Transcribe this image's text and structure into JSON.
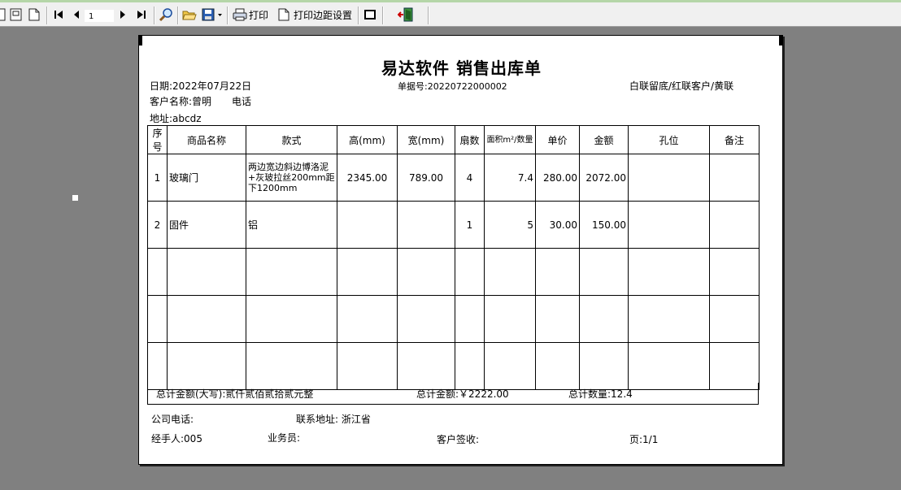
{
  "toolbar": {
    "page_number": "1",
    "print_label": "打印",
    "print_margin_label": "打印边距设置"
  },
  "icons": [
    "page-view-icon",
    "two-page-icon",
    "blank-page-icon",
    "first-page-icon",
    "prev-page-icon",
    "next-page-icon",
    "last-page-icon",
    "zoom-icon",
    "open-folder-icon",
    "save-disk-icon",
    "dropdown-arrow-icon",
    "printer-icon",
    "page-setup-icon",
    "fullscreen-icon",
    "exit-icon"
  ],
  "document": {
    "title": "易达软件 销售出库单",
    "date": "日期:2022年07月22日",
    "bill_no": "单据号:20220722000002",
    "copy_note": "白联留底/红联客户/黄联",
    "customer_name": "客户名称:曾明",
    "phone_label": "电话",
    "address": "地址:abcdz",
    "columns": [
      "序号",
      "商品名称",
      "款式",
      "高(mm)",
      "宽(mm)",
      "扇数",
      "面积m²/数量",
      "单价",
      "金额",
      "孔位",
      "备注"
    ],
    "rows": [
      {
        "no": "1",
        "name": "玻璃门",
        "style": "两边宽边斜边博洛泥+灰玻拉丝200mm距下1200mm",
        "height": "2345.00",
        "width": "789.00",
        "leaves": "4",
        "area": "7.4",
        "price": "280.00",
        "amount": "2072.00",
        "holes": "",
        "note": ""
      },
      {
        "no": "2",
        "name": "固件",
        "style": "铝",
        "height": "",
        "width": "",
        "leaves": "1",
        "area": "5",
        "price": "30.00",
        "amount": "150.00",
        "holes": "",
        "note": ""
      }
    ],
    "total_upper": "总计金额(大写):贰仟贰佰贰拾贰元整",
    "total_amount": "总计金额:￥2222.00",
    "total_qty": "总计数量:12.4",
    "company_phone": "公司电话:",
    "contact_address": "联系地址: 浙江省",
    "handler": "经手人:005",
    "salesman": "业务员:",
    "receiver": "客户签收:",
    "page": "页:1/1"
  }
}
